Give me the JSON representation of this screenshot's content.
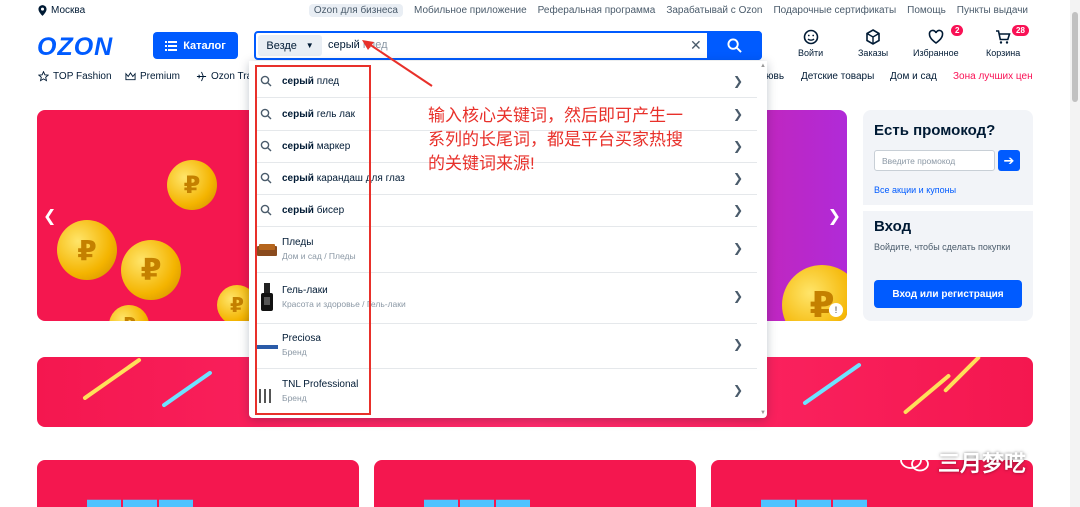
{
  "top_bar": {
    "location": "Москва",
    "links": [
      "Ozon для бизнеса",
      "Мобильное приложение",
      "Реферальная программа",
      "Зарабатывай с Ozon",
      "Подарочные сертификаты",
      "Помощь",
      "Пункты выдачи"
    ]
  },
  "header": {
    "logo": "OZON",
    "catalog_label": "Каталог",
    "search": {
      "scope": "Везде",
      "query_typed": "серый",
      "query_hint": " плед"
    },
    "icons": [
      {
        "label": "Войти",
        "icon": "face-icon",
        "badge": ""
      },
      {
        "label": "Заказы",
        "icon": "box-icon",
        "badge": ""
      },
      {
        "label": "Избранное",
        "icon": "heart-icon",
        "badge": "2"
      },
      {
        "label": "Корзина",
        "icon": "cart-icon",
        "badge": "28"
      }
    ]
  },
  "nav": {
    "items": [
      "TOP Fashion",
      "Premium",
      "Ozon Tra",
      "ювь",
      "Детские товары",
      "Дом и сад",
      "Зона лучших цен"
    ]
  },
  "dropdown": {
    "suggestions": [
      {
        "bold": "серый",
        "rest": " плед"
      },
      {
        "bold": "серый",
        "rest": " гель лак"
      },
      {
        "bold": "серый",
        "rest": " маркер"
      },
      {
        "bold": "серый",
        "rest": " карандаш для глаз"
      },
      {
        "bold": "серый",
        "rest": " бисер"
      }
    ],
    "categories": [
      {
        "title": "Пледы",
        "path": "Дом и сад  /  Пледы"
      },
      {
        "title": "Гель-лаки",
        "path": "Красота и здоровье  /  Гель-лаки"
      }
    ],
    "brands": [
      {
        "title": "Preciosa",
        "sub": "Бренд"
      },
      {
        "title": "TNL Professional",
        "sub": "Бренд"
      }
    ]
  },
  "promo": {
    "title": "Есть промокод?",
    "placeholder": "Введите промокод",
    "link": "Все акции и купоны",
    "login_title": "Вход",
    "login_text": "Войдите, чтобы сделать покупки",
    "login_button": "Вход или регистрация"
  },
  "annotation": {
    "text": "输入核心关键词，然后即可产生一系列的长尾词，都是平台买家热搜的关键词来源!"
  },
  "watermark": "三月梦呓",
  "colors": {
    "brand": "#005bff",
    "hero": "#f4174f",
    "annotation": "#e8302a",
    "badge": "#f91155"
  }
}
